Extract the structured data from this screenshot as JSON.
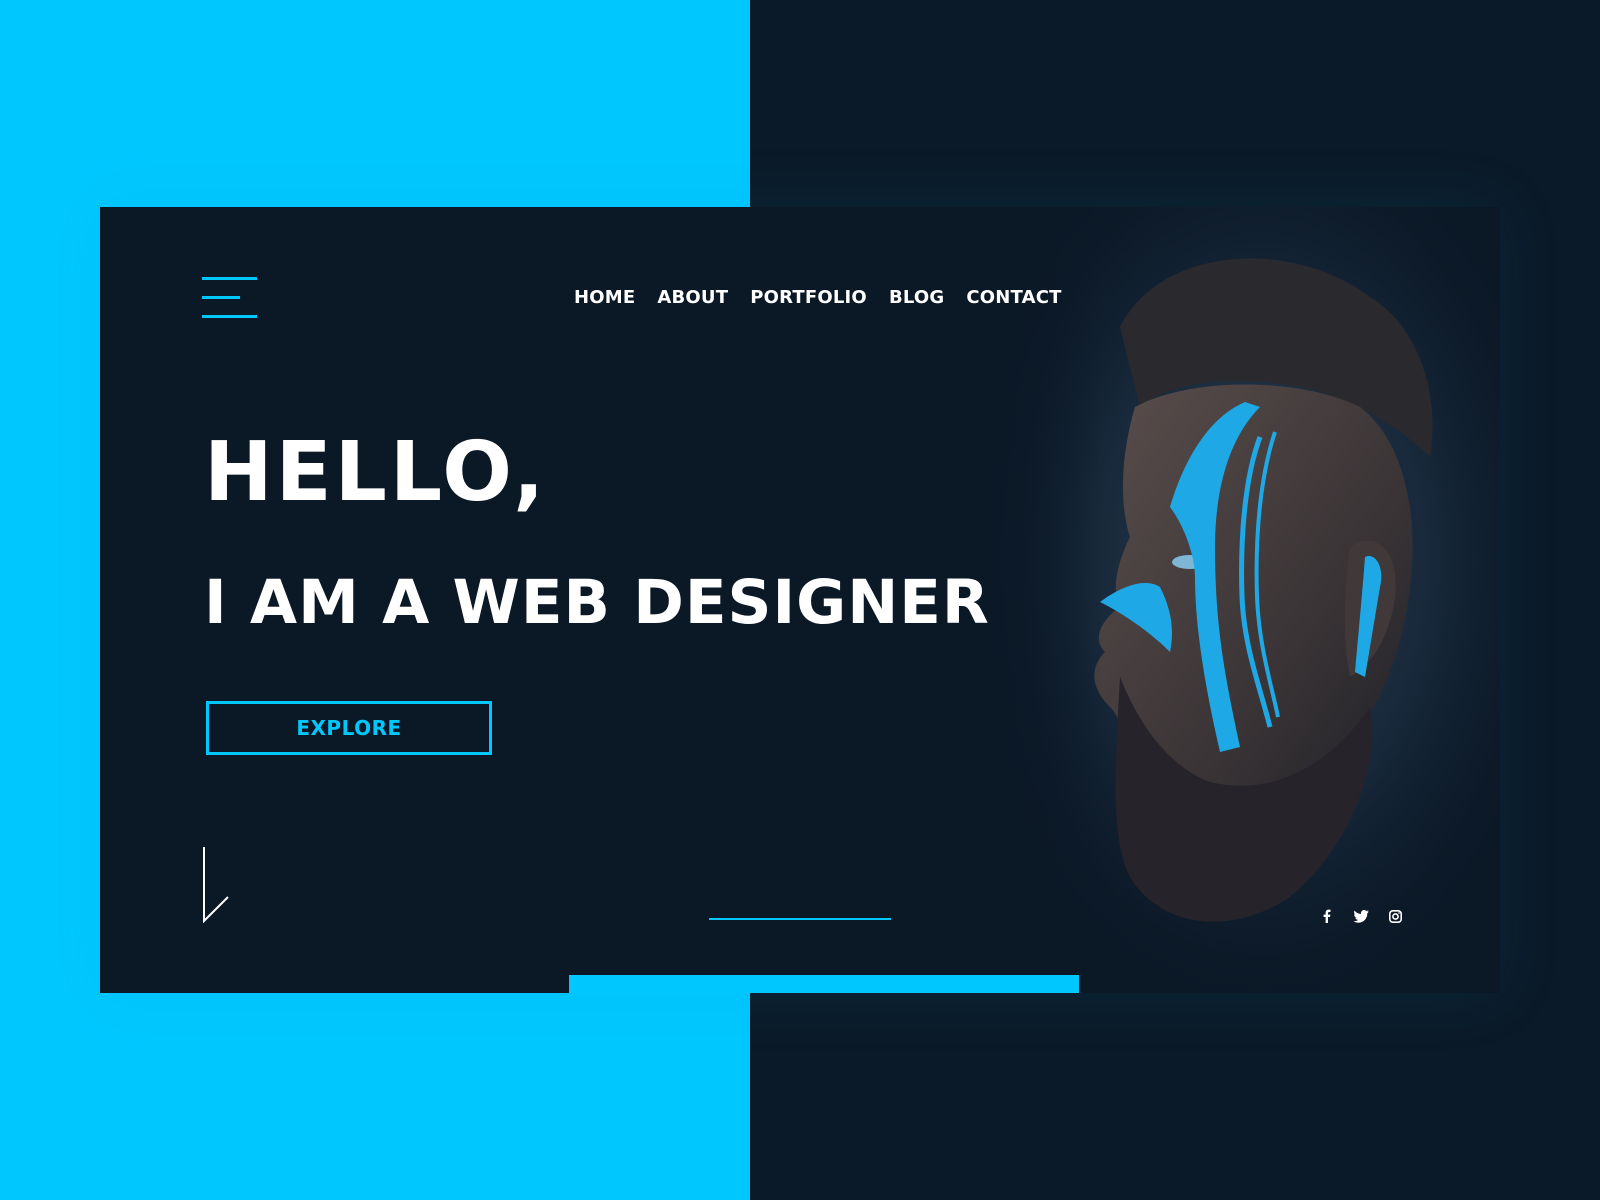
{
  "nav": {
    "items": [
      "HOME",
      "ABOUT",
      "PORTFOLIO",
      "BLOG",
      "CONTACT"
    ]
  },
  "hero": {
    "greeting": "HELLO,",
    "subline": "I AM A WEB DESIGNER",
    "cta_label": "EXPLORE"
  },
  "socials": [
    "facebook-icon",
    "twitter-icon",
    "instagram-icon"
  ],
  "colors": {
    "accent": "#00c8ff",
    "background": "#0b1a28",
    "card": "#0b1826",
    "text": "#ffffff"
  }
}
